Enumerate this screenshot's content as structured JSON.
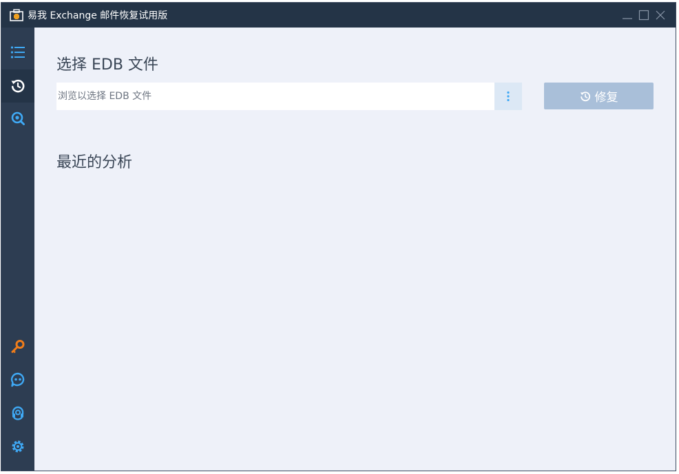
{
  "window": {
    "title": "易我 Exchange 邮件恢复试用版"
  },
  "sidebar": {
    "items": [
      {
        "icon": "list-icon",
        "color": "#3fa9f5"
      },
      {
        "icon": "restore-icon",
        "color": "#ffffff",
        "active": true
      },
      {
        "icon": "search-icon",
        "color": "#3fa9f5"
      }
    ],
    "bottom_items": [
      {
        "icon": "key-icon",
        "color": "#f07d1a"
      },
      {
        "icon": "chat-icon",
        "color": "#3fa9f5"
      },
      {
        "icon": "support-icon",
        "color": "#3fa9f5"
      },
      {
        "icon": "settings-icon",
        "color": "#3fa9f5"
      }
    ]
  },
  "main": {
    "select_title": "选择 EDB 文件",
    "file_input": {
      "placeholder": "浏览以选择 EDB 文件",
      "value": ""
    },
    "repair_button_label": "修复",
    "recent_title": "最近的分析"
  },
  "colors": {
    "titlebar": "#243447",
    "sidebar": "#2d3d52",
    "accent": "#3fa9f5",
    "repair_button_disabled": "#a9bfd9"
  }
}
